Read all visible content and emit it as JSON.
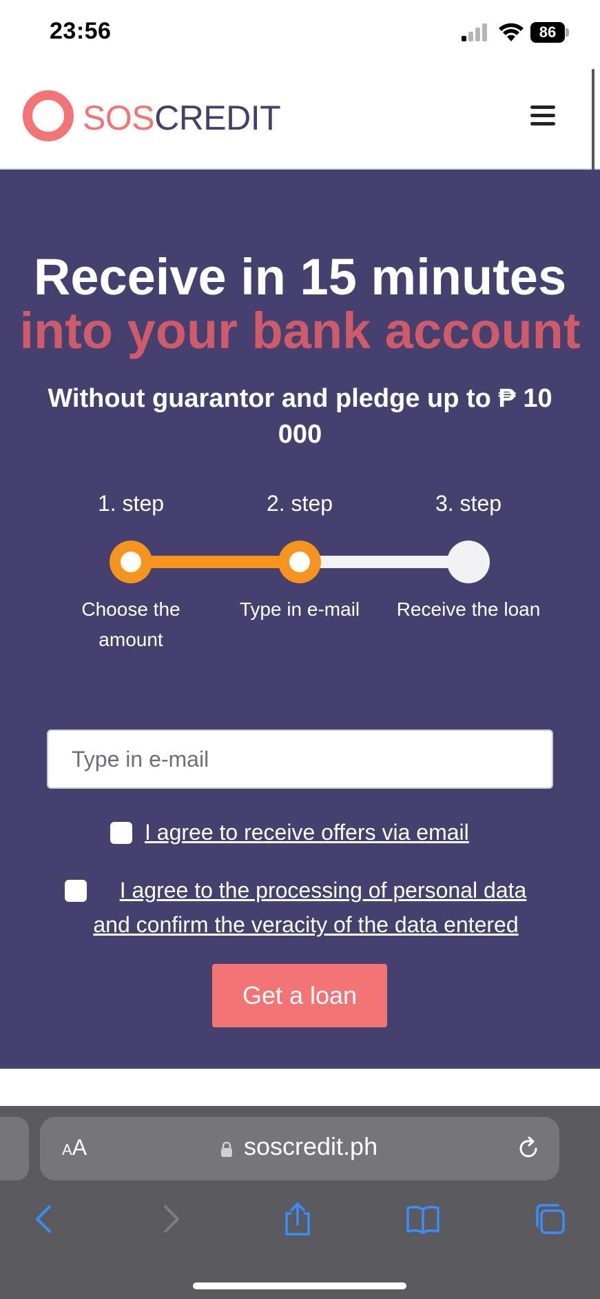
{
  "status_bar": {
    "time": "23:56",
    "battery": "86"
  },
  "header": {
    "logo_sos": "SOS",
    "logo_credit": "CREDIT",
    "colors": {
      "sos": "#f27474",
      "credit": "#44406a"
    }
  },
  "hero": {
    "title": "Receive in 15 minutes",
    "title_accent": "into your bank account",
    "subtitle": "Without guarantor and pledge up to ₱ 10 000",
    "colors": {
      "background": "#45406e",
      "accent": "#cf5b6a"
    }
  },
  "steps": {
    "items": [
      {
        "label": "1. step",
        "description": "Choose the amount",
        "state": "done"
      },
      {
        "label": "2. step",
        "description": "Type in e-mail",
        "state": "current"
      },
      {
        "label": "3. step",
        "description": "Receive the loan",
        "state": "pending"
      }
    ],
    "progress_color": "#f7941d"
  },
  "form": {
    "email_placeholder": "Type in e-mail",
    "email_value": "",
    "consent_offers": "I agree to receive offers via email",
    "consent_offers_checked": false,
    "consent_data": "I agree to the processing of personal data and confirm the veracity of the data entered",
    "consent_data_checked": false,
    "submit_label": "Get a loan",
    "submit_color": "#f27474"
  },
  "browser": {
    "text_size_label_small": "A",
    "text_size_label_large": "A",
    "url": "soscredit.ph",
    "icons": [
      "back-icon",
      "forward-icon",
      "share-icon",
      "bookmarks-icon",
      "tabs-icon"
    ]
  }
}
